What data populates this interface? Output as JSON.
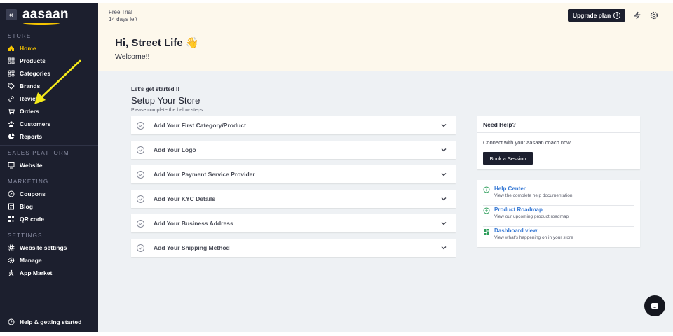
{
  "sidebar": {
    "logo": "aasaan",
    "collapse_glyph": "«",
    "sections": [
      {
        "label": "STORE",
        "items": [
          {
            "label": "Home",
            "icon": "home-icon",
            "active": true
          },
          {
            "label": "Products",
            "icon": "grid-icon"
          },
          {
            "label": "Categories",
            "icon": "categories-icon"
          },
          {
            "label": "Brands",
            "icon": "tag-icon"
          },
          {
            "label": "Reviews",
            "icon": "link-icon"
          },
          {
            "label": "Orders",
            "icon": "cart-icon"
          },
          {
            "label": "Customers",
            "icon": "users-icon"
          },
          {
            "label": "Reports",
            "icon": "chart-icon"
          }
        ]
      },
      {
        "label": "SALES PLATFORM",
        "items": [
          {
            "label": "Website",
            "icon": "monitor-icon"
          }
        ]
      },
      {
        "label": "MARKETING",
        "items": [
          {
            "label": "Coupons",
            "icon": "coupon-icon"
          },
          {
            "label": "Blog",
            "icon": "blog-icon"
          },
          {
            "label": "QR code",
            "icon": "qr-icon"
          }
        ]
      },
      {
        "label": "SETTINGS",
        "items": [
          {
            "label": "Website settings",
            "icon": "settings-icon"
          },
          {
            "label": "Manage",
            "icon": "gear-icon"
          },
          {
            "label": "App Market",
            "icon": "app-market-icon"
          }
        ]
      }
    ],
    "bottom_label": "Help & getting started"
  },
  "header": {
    "trial_line1": "Free Trial",
    "trial_line2": "14 days left",
    "upgrade_label": "Upgrade plan"
  },
  "banner": {
    "greeting": "Hi, Street Life 👋",
    "welcome": "Welcome!!"
  },
  "setup": {
    "kicker": "Let's get started !!",
    "title": "Setup Your Store",
    "subtitle": "Please complete the below steps:",
    "steps": [
      "Add Your First Category/Product",
      "Add Your Logo",
      "Add Your Payment Service Provider",
      "Add Your KYC Details",
      "Add Your Business Address",
      "Add Your Shipping Method"
    ]
  },
  "help": {
    "title": "Need Help?",
    "text": "Connect with your aasaan coach now!",
    "button": "Book a Session"
  },
  "links": [
    {
      "title": "Help Center",
      "desc": "View the complete help documentation",
      "icon": "info-icon",
      "color": "#2e9e5b"
    },
    {
      "title": "Product Roadmap",
      "desc": "View our upcoming product roadmap",
      "icon": "plus-circle-icon",
      "color": "#2e9e5b"
    },
    {
      "title": "Dashboard view",
      "desc": "View what's happening on in your store",
      "icon": "dashboard-icon",
      "color": "#2e9e5b"
    }
  ],
  "colors": {
    "sidebar_bg": "#1c1f2e",
    "accent": "#f5c400",
    "link": "#3a7bd5",
    "banner_bg": "#fdf8ec",
    "annotation_arrow": "#f5ea1a"
  }
}
